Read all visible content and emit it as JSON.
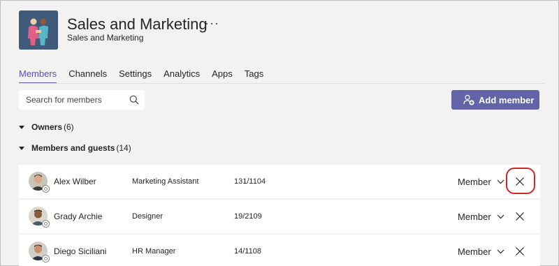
{
  "team": {
    "title": "Sales and Marketing",
    "subtitle": "Sales and Marketing",
    "more": "···",
    "logo_icon": "people-handshake-icon"
  },
  "tabs": [
    {
      "label": "Members",
      "active": true
    },
    {
      "label": "Channels",
      "active": false
    },
    {
      "label": "Settings",
      "active": false
    },
    {
      "label": "Analytics",
      "active": false
    },
    {
      "label": "Apps",
      "active": false
    },
    {
      "label": "Tags",
      "active": false
    }
  ],
  "search": {
    "placeholder": "Search for members",
    "value": "",
    "icon": "search-icon"
  },
  "add_member": {
    "label": "Add member",
    "icon": "add-person-icon",
    "color": "#6264a7"
  },
  "sections": {
    "owners": {
      "label": "Owners",
      "count": "(6)"
    },
    "members": {
      "label": "Members and guests",
      "count": "(14)"
    }
  },
  "members": [
    {
      "name": "Alex Wilber",
      "title": "Marketing Assistant",
      "location": "131/1104",
      "role": "Member",
      "highlighted": true
    },
    {
      "name": "Grady Archie",
      "title": "Designer",
      "location": "19/2109",
      "role": "Member",
      "highlighted": false
    },
    {
      "name": "Diego Siciliani",
      "title": "HR Manager",
      "location": "14/1108",
      "role": "Member",
      "highlighted": false
    }
  ],
  "colors": {
    "accent": "#6264a7",
    "highlight": "#d1242b",
    "background": "#f3f2f1"
  }
}
